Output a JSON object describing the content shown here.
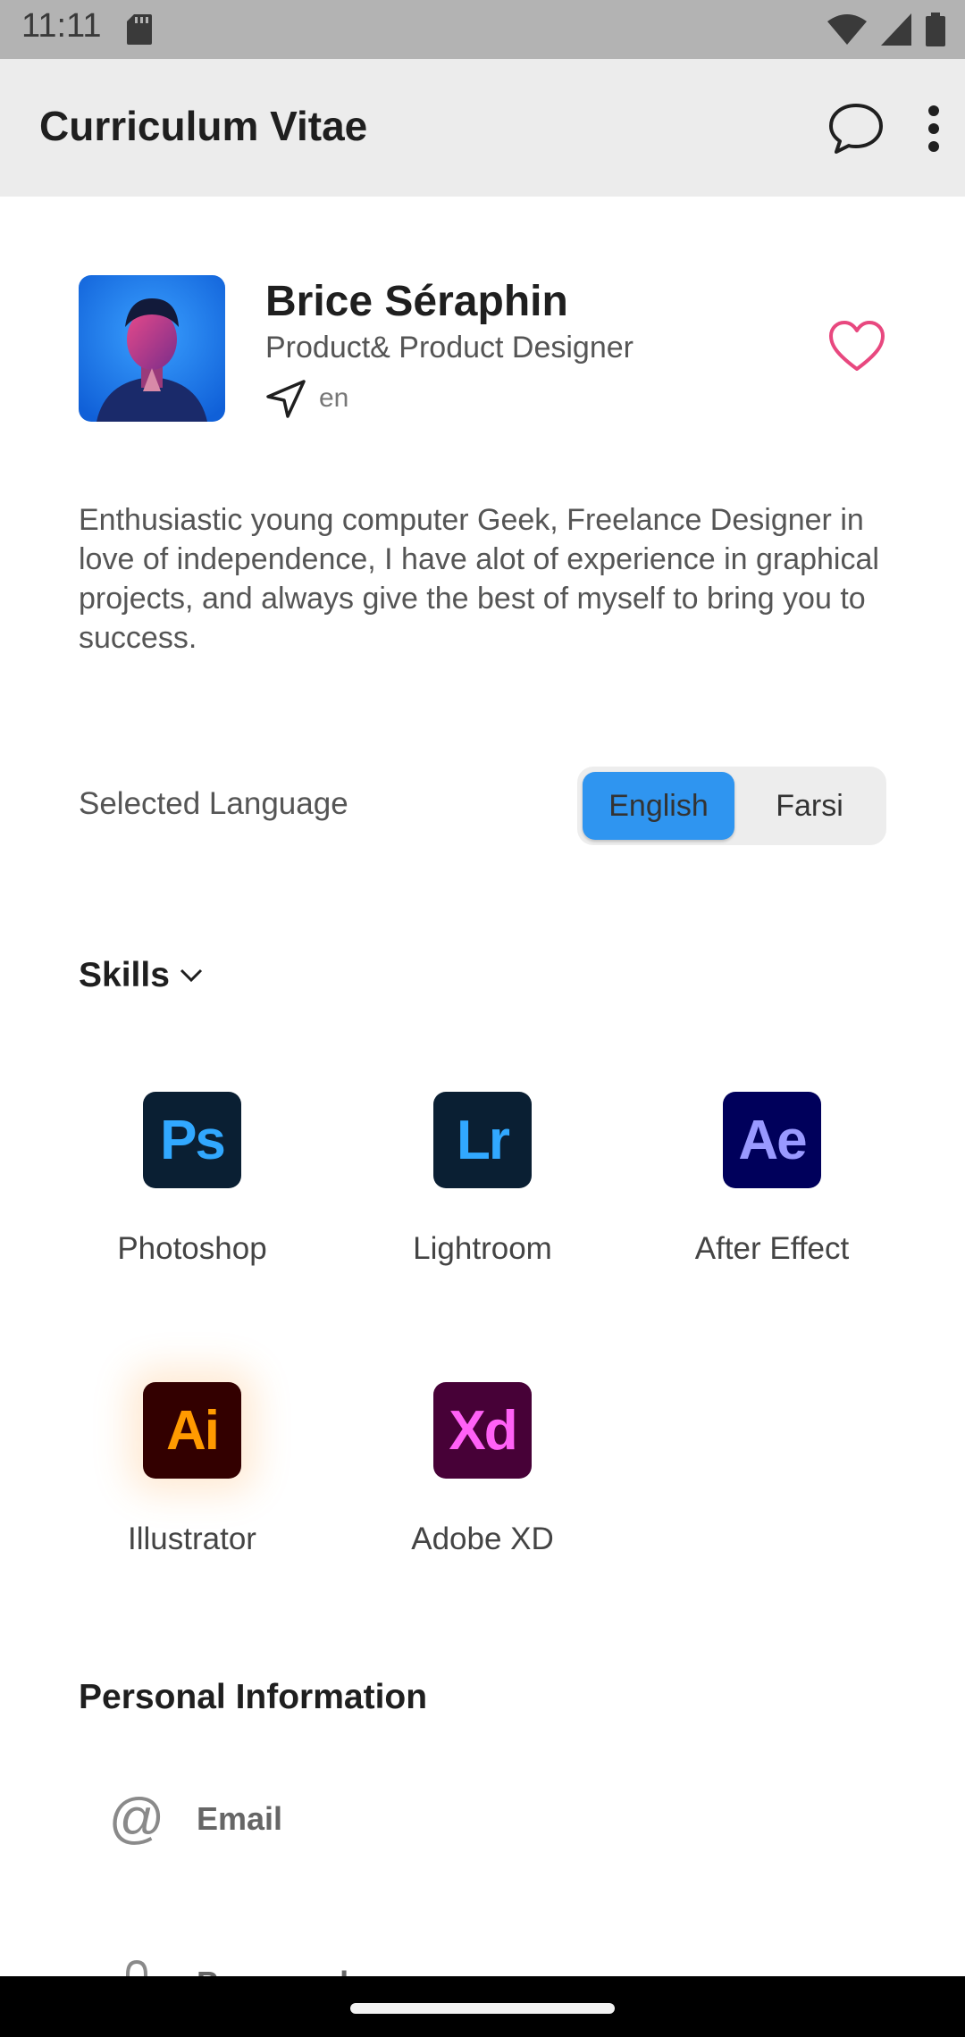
{
  "status_bar": {
    "time": "11:11"
  },
  "app_bar": {
    "title": "Curriculum Vitae"
  },
  "profile": {
    "name": "Brice Séraphin",
    "role": "Product& Product Designer",
    "language_code": "en",
    "bio": "Enthusiastic young computer Geek, Freelance Designer in love of independence, I have alot of experience in graphical projects, and always give the best of myself to bring you to success."
  },
  "language": {
    "label": "Selected Language",
    "options": [
      "English",
      "Farsi"
    ],
    "selected": "English"
  },
  "skills": {
    "title": "Skills",
    "items": [
      {
        "abbr": "Ps",
        "label": "Photoshop",
        "bg": "#0a1f33",
        "fg": "#31a8ff"
      },
      {
        "abbr": "Lr",
        "label": "Lightroom",
        "bg": "#0a1f33",
        "fg": "#31a8ff"
      },
      {
        "abbr": "Ae",
        "label": "After Effect",
        "bg": "#00005b",
        "fg": "#9999ff"
      },
      {
        "abbr": "Ai",
        "label": "Illustrator",
        "bg": "#330000",
        "fg": "#ff9a00"
      },
      {
        "abbr": "Xd",
        "label": "Adobe XD",
        "bg": "#470137",
        "fg": "#ff61f6"
      }
    ]
  },
  "personal_info": {
    "title": "Personal Information",
    "fields": [
      {
        "icon": "at-icon",
        "label": "Email"
      },
      {
        "icon": "lock-icon",
        "label": "Password"
      }
    ]
  },
  "colors": {
    "accent": "#2f95f0",
    "favorite": "#e8487f"
  }
}
